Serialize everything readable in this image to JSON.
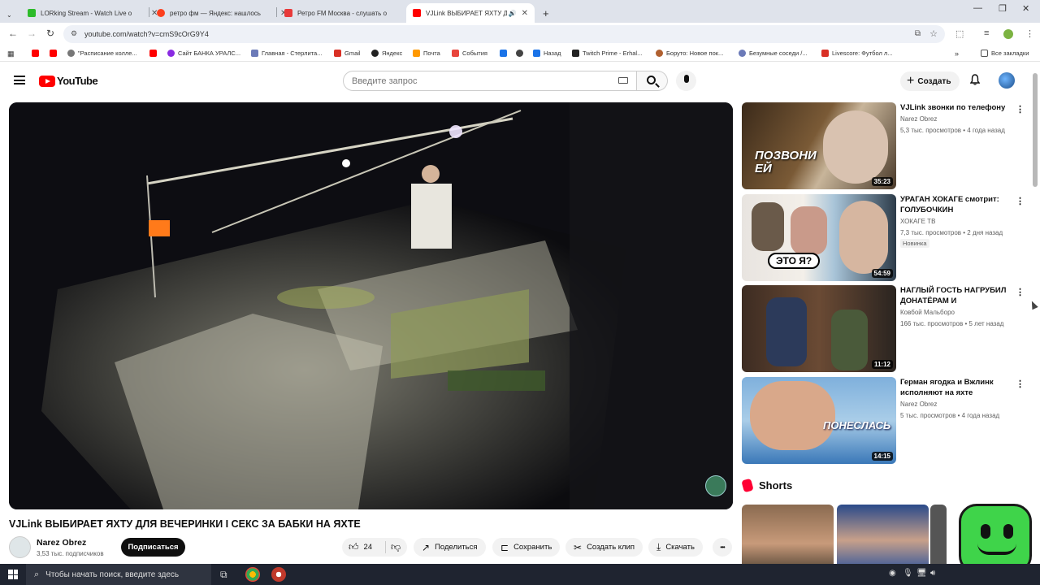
{
  "browser": {
    "tabs": [
      {
        "label": "LORking Stream - Watch Live o",
        "color": "#2dbb2a"
      },
      {
        "label": "ретро фм — Яндекс: нашлось",
        "color": "#fc3f1d"
      },
      {
        "label": "Ретро FM Москва - слушать о",
        "color": "#e83a3a"
      },
      {
        "label": "VJLink ВЫБИРАЕТ ЯХТУ ДЛ",
        "color": "#ff0000"
      }
    ],
    "new_tab_symbol": "+",
    "url": "youtube.com/watch?v=cmS9cOrG9Y4",
    "bookmarks": [
      {
        "label": "",
        "color": "#ff0000"
      },
      {
        "label": "",
        "color": "#ff0000"
      },
      {
        "label": "\"Расписание колле...",
        "color": "#777777"
      },
      {
        "label": "",
        "color": "#ff0000"
      },
      {
        "label": "Сайт БАНКА УРАЛС...",
        "color": "#8a2be2"
      },
      {
        "label": "Главная - Стерлита...",
        "color": "#6b7ab8"
      },
      {
        "label": "Gmail",
        "color": "#d93025"
      },
      {
        "label": "Яндекс",
        "color": "#222222"
      },
      {
        "label": "Почта",
        "color": "#ff9900"
      },
      {
        "label": "События",
        "color": "#e8453c"
      },
      {
        "label": "",
        "color": "#1a73e8"
      },
      {
        "label": "",
        "color": "#444444"
      },
      {
        "label": "Назад",
        "color": "#1a73e8"
      },
      {
        "label": "Twitch Prime - Erhal...",
        "color": "#222222"
      },
      {
        "label": "Боруто: Новое пок...",
        "color": "#b06030"
      },
      {
        "label": "Безумные соседи /...",
        "color": "#6b7ab8"
      },
      {
        "label": "Livescore: Футбол л...",
        "color": "#d93025"
      }
    ],
    "all_bookmarks": "Все закладки"
  },
  "youtube": {
    "logo_text": "YouTube",
    "search_placeholder": "Введите запрос",
    "create_label": "Создать",
    "video": {
      "title": "VJLink ВЫБИРАЕТ ЯХТУ ДЛЯ ВЕЧЕРИНКИ I СЕКС ЗА БАБКИ НА ЯХТЕ",
      "channel": "Narez Obrez",
      "subscribers": "3,53 тыс. подписчиков",
      "subscribe_label": "Подписаться",
      "likes": "24",
      "share_label": "Поделиться",
      "save_label": "Сохранить",
      "clip_label": "Создать клип",
      "download_label": "Скачать",
      "more_label": "•••"
    },
    "recommendations": [
      {
        "title": "VJLink звонки по телефону",
        "channel": "Narez Obrez",
        "meta": "5,3 тыс. просмотров • 4 года назад",
        "duration": "35:23",
        "badge": "",
        "thumb_text": "ПОЗВОНИ ЕЙ"
      },
      {
        "title": "УРАГАН ХОКАГЕ смотрит: ГОЛУБОЧКИН УНИЧТОЖАЕТ...",
        "channel": "ХОКАГЕ ТВ",
        "meta": "7,3 тыс. просмотров • 2 дня назад",
        "duration": "54:59",
        "badge": "Новинка",
        "thumb_text": "ЭТО Я?"
      },
      {
        "title": "НАГЛЫЙ ГОСТЬ НАГРУБИЛ ДОНАТЁРАМ И ПОПЛАТИЛС...",
        "channel": "Ковбой Мальборо",
        "meta": "166 тыс. просмотров • 5 лет назад",
        "duration": "11:12",
        "badge": "",
        "thumb_text": ""
      },
      {
        "title": "Герман ягодка и Вжлинк исполняют на яхте",
        "channel": "Narez Obrez",
        "meta": "5 тыс. просмотров • 4 года назад",
        "duration": "14:15",
        "badge": "",
        "thumb_text": "ПОНЕСЛАСЬ"
      }
    ],
    "shorts_label": "Shorts"
  },
  "taskbar": {
    "search_placeholder": "Чтобы начать поиск, введите здесь"
  }
}
